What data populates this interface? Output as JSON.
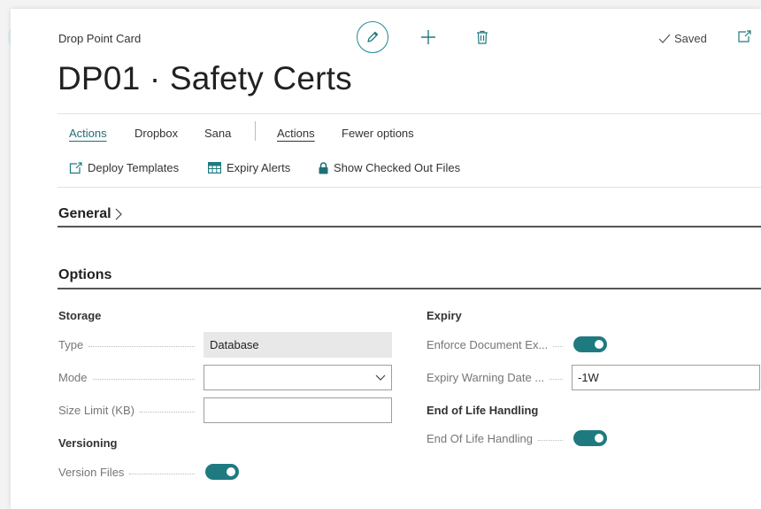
{
  "header": {
    "breadcrumb": "Drop Point Card",
    "title": "DP01 · Safety Certs",
    "saved_label": "Saved"
  },
  "tabs": [
    {
      "label": "Actions"
    },
    {
      "label": "Dropbox"
    },
    {
      "label": "Sana"
    },
    {
      "label": "Actions"
    },
    {
      "label": "Fewer options"
    }
  ],
  "actions": [
    {
      "label": "Deploy Templates",
      "icon": "deploy-icon"
    },
    {
      "label": "Expiry Alerts",
      "icon": "table-icon"
    },
    {
      "label": "Show Checked Out Files",
      "icon": "lock-icon"
    }
  ],
  "sections": {
    "general": "General",
    "options": "Options"
  },
  "storage": {
    "heading": "Storage",
    "type_label": "Type",
    "type_value": "Database",
    "mode_label": "Mode",
    "mode_value": "",
    "size_label": "Size Limit (KB)",
    "size_value": ""
  },
  "versioning": {
    "heading": "Versioning",
    "version_files_label": "Version Files",
    "version_files_on": true
  },
  "expiry": {
    "heading": "Expiry",
    "enforce_label": "Enforce Document Ex...",
    "enforce_on": true,
    "warning_label": "Expiry Warning Date ...",
    "warning_value": "-1W"
  },
  "end_of_life": {
    "heading": "End of Life Handling",
    "label": "End Of Life Handling",
    "on": true
  },
  "colors": {
    "accent": "#1f7a80",
    "tab_active": "#1f6f76"
  }
}
